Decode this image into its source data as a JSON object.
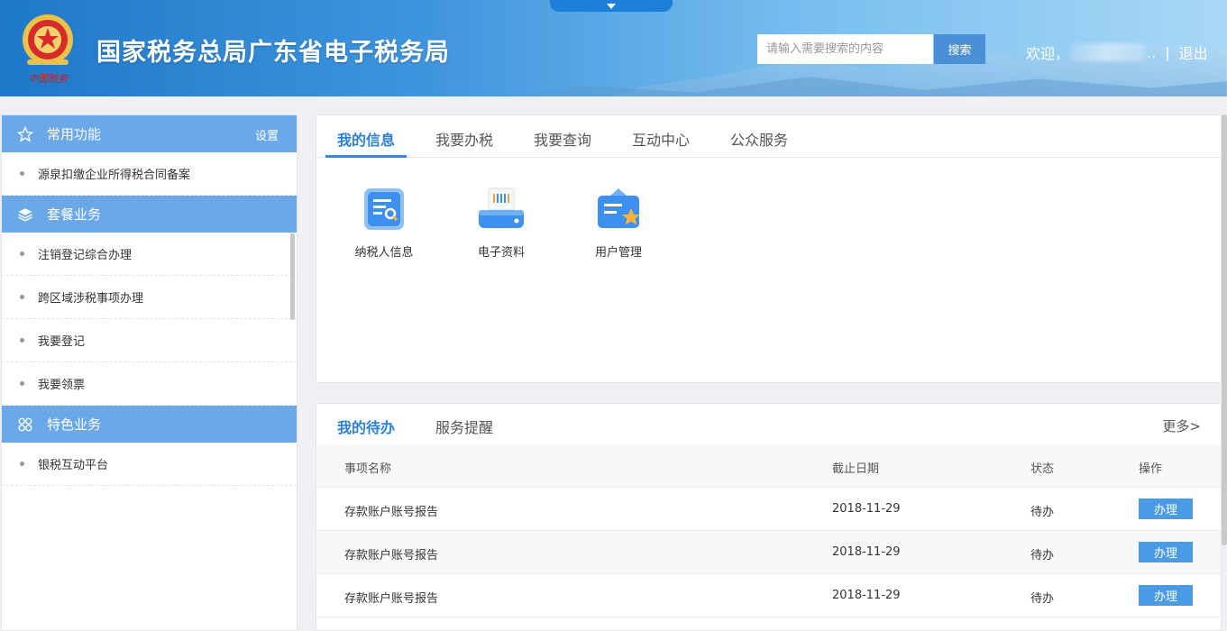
{
  "header": {
    "site_title": "国家税务总局广东省电子税务局",
    "emblem_text": "中国税务",
    "search_placeholder": "请输入需要搜索的内容",
    "search_button": "搜索",
    "welcome": "欢迎，",
    "welcome_suffix": "..",
    "separator": "|",
    "logout": "退出"
  },
  "sidebar": {
    "sections": [
      {
        "title": "常用功能",
        "icon": "star-icon",
        "action": "设置",
        "items": [
          "源泉扣缴企业所得税合同备案"
        ]
      },
      {
        "title": "套餐业务",
        "icon": "layers-icon",
        "items": [
          "注销登记综合办理",
          "跨区域涉税事项办理",
          "我要登记",
          "我要领票"
        ]
      },
      {
        "title": "特色业务",
        "icon": "grid-icon",
        "items": [
          "银税互动平台"
        ]
      }
    ]
  },
  "info_panel": {
    "tabs": [
      "我的信息",
      "我要办税",
      "我要查询",
      "互动中心",
      "公众服务"
    ],
    "active_tab": 0,
    "icons": [
      {
        "label": "纳税人信息",
        "icon": "taxpayer-info-icon"
      },
      {
        "label": "电子资料",
        "icon": "e-documents-icon"
      },
      {
        "label": "用户管理",
        "icon": "user-management-icon"
      }
    ]
  },
  "todo_panel": {
    "tabs": [
      "我的待办",
      "服务提醒"
    ],
    "more": "更多>",
    "columns": [
      "事项名称",
      "截止日期",
      "状态",
      "操作"
    ],
    "rows": [
      {
        "name": "存款账户账号报告",
        "date": "2018-11-29",
        "status": "待办",
        "action": "办理"
      },
      {
        "name": "存款账户账号报告",
        "date": "2018-11-29",
        "status": "待办",
        "action": "办理"
      },
      {
        "name": "存款账户账号报告",
        "date": "2018-11-29",
        "status": "待办",
        "action": "办理"
      }
    ]
  },
  "colors": {
    "accent": "#2b7fd6",
    "sidebar_header": "#6aa8e8",
    "button": "#4a9be6"
  }
}
